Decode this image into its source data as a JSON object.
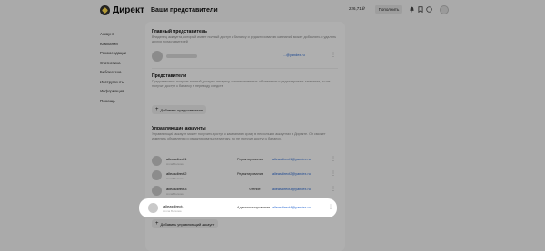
{
  "header": {
    "logo_text": "Директ",
    "page_title": "Ваши представители",
    "balance": "226,71 ₽",
    "topup_label": "Пополнить",
    "icons": [
      "bell-icon",
      "bookmark-icon",
      "help-icon"
    ]
  },
  "sidebar": {
    "items": [
      {
        "label": "Аккаунт"
      },
      {
        "label": "Кампании"
      },
      {
        "label": "Рекомендации"
      },
      {
        "label": "Статистика"
      },
      {
        "label": "Библиотека"
      },
      {
        "label": "Инструменты"
      },
      {
        "label": "Информация"
      },
      {
        "label": "Помощь"
      }
    ]
  },
  "main_rep": {
    "title": "Главный представитель",
    "description": "Владелец аккаунта, который имеет полный доступ к балансу и редактированию кампаний может добавлять и удалять других представителей",
    "email": "...@yandex.ru"
  },
  "reps": {
    "title": "Представители",
    "description": "Представитель получит полный доступ к аккаунту, сможет изменять объявления и редактировать кампании, но не получит доступ к балансу и переводу средств",
    "add_label": "Добавить представителя"
  },
  "managing": {
    "title": "Управляющие аккаунты",
    "description": "Управляющий аккаунт может получить доступ к кампаниям сразу в нескольких аккаунтах в Директе. Он сможет изменять объявления и редактировать статистику, но не получит доступ к балансу.",
    "accounts": [
      {
        "login": "alleasdirect1",
        "sub": "Алла Волкова",
        "role": "Редактирование",
        "email": "alleasdirect1@yandex.ru"
      },
      {
        "login": "alleasdirect2",
        "sub": "Алла Волкова",
        "role": "Редактирование",
        "email": "alleasdirect2@yandex.ru"
      },
      {
        "login": "alleasdirect3",
        "sub": "Алла Волкова",
        "role": "Чтение",
        "email": "alleasdirect3@yandex.ru"
      }
    ],
    "highlighted": {
      "login": "alleasdirect4",
      "sub": "Алла Волкова",
      "role": "Администрирование",
      "email": "alleasdirect4@yandex.ru"
    },
    "add_label": "Добавить управляющий аккаунт"
  }
}
